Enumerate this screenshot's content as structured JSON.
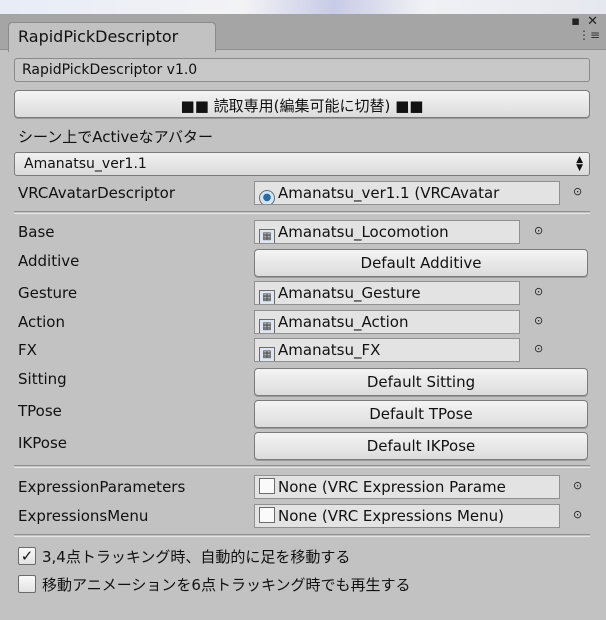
{
  "window": {
    "tab_title": "RapidPickDescriptor",
    "pin_glyph": "▪",
    "close_glyph": "✕",
    "menu_glyph": "⋮≡"
  },
  "header": {
    "version": "RapidPickDescriptor v1.0",
    "readonly_button": "■■ 読取専用(編集可能に切替) ■■"
  },
  "avatar_select": {
    "label": "シーン上でActiveなアバター",
    "selected": "Amanatsu_ver1.1"
  },
  "descriptor": {
    "label": "VRCAvatarDescriptor",
    "value": "Amanatsu_ver1.1 (VRCAvatar"
  },
  "layers": {
    "base": {
      "label": "Base",
      "value": "Amanatsu_Locomotion"
    },
    "additive": {
      "label": "Additive",
      "button": "Default Additive"
    },
    "gesture": {
      "label": "Gesture",
      "value": "Amanatsu_Gesture"
    },
    "action": {
      "label": "Action",
      "value": "Amanatsu_Action"
    },
    "fx": {
      "label": "FX",
      "value": "Amanatsu_FX"
    },
    "sitting": {
      "label": "Sitting",
      "button": "Default Sitting"
    },
    "tpose": {
      "label": "TPose",
      "button": "Default TPose"
    },
    "ikpose": {
      "label": "IKPose",
      "button": "Default IKPose"
    }
  },
  "expressions": {
    "parameters": {
      "label": "ExpressionParameters",
      "value": "None (VRC Expression Parame"
    },
    "menu": {
      "label": "ExpressionsMenu",
      "value": "None (VRC Expressions Menu)"
    }
  },
  "options": {
    "auto_foot": {
      "label": "3,4点トラッキング時、自動的に足を移動する",
      "checked": true
    },
    "play_6pt": {
      "label": "移動アニメーションを6点トラッキング時でも再生する",
      "checked": false
    }
  },
  "icons": {
    "object_picker": "⊙",
    "checkmark": "✓"
  },
  "colors": {
    "panel_bg": "#c2c2c2",
    "tabbar_bg": "#a5a5a5",
    "button_bg": "#e8e8e8"
  }
}
